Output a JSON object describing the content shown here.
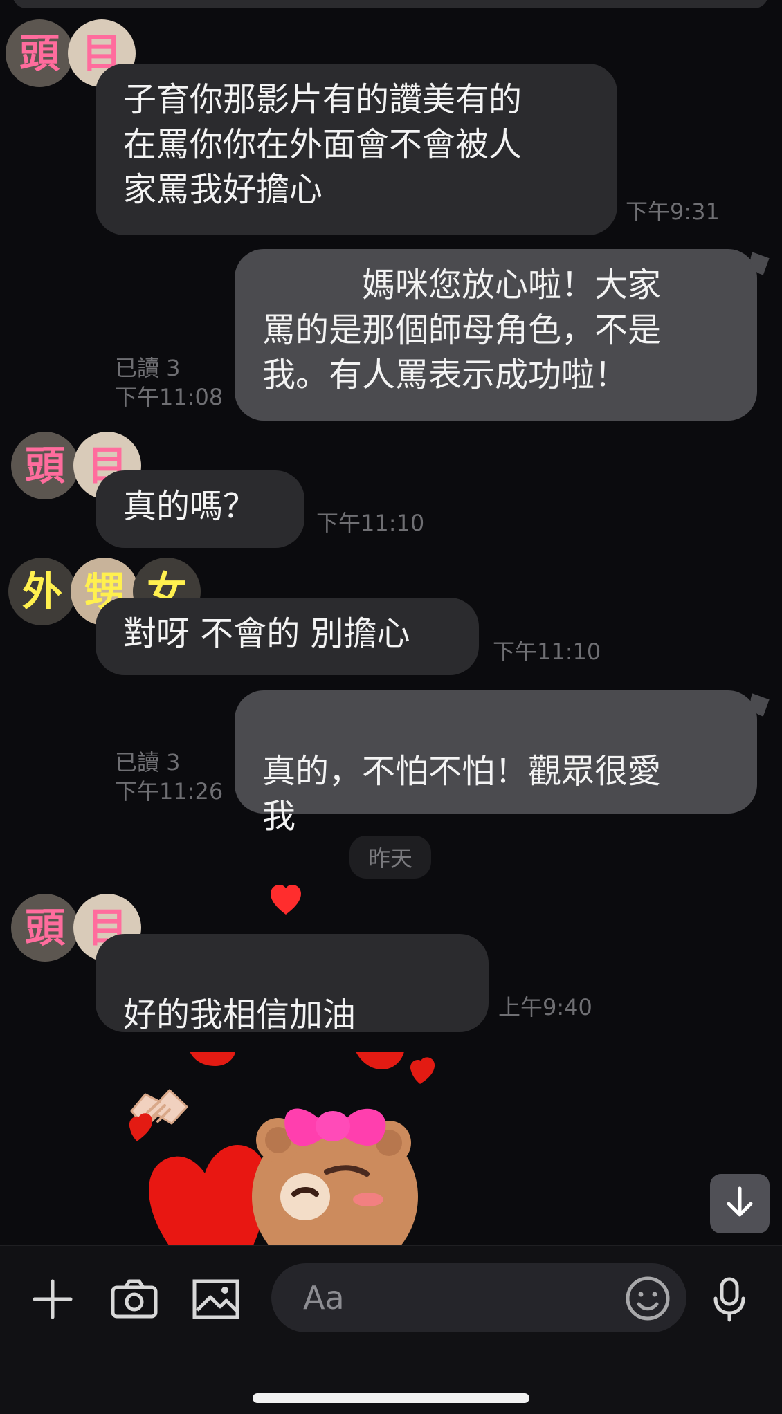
{
  "messages": [
    {
      "text": "子育你那影片有的讚美有的\n在罵你你在外面會不會被人\n家罵我好擔心",
      "time": "下午9:31"
    },
    {
      "text": "　　　媽咪您放心啦！大家\n罵的是那個師母角色，不是\n我。有人罵表示成功啦！",
      "read": "已讀 3",
      "time": "下午11:08"
    },
    {
      "text": "真的嗎？",
      "time": "下午11:10"
    },
    {
      "text": "對呀 不會的 別擔心",
      "time": "下午11:10"
    },
    {
      "text": "真的，不怕不怕！觀眾很愛\n我",
      "read": "已讀 3",
      "time": "下午11:26"
    },
    {
      "text": "好的我相信加油",
      "time": "上午9:40"
    }
  ],
  "senders": {
    "head": [
      "頭",
      "目"
    ],
    "niece": [
      "外",
      "甥",
      "女"
    ]
  },
  "date_separator": "昨天",
  "input_bar": {
    "placeholder": "Aa",
    "icons": [
      "plus-icon",
      "camera-icon",
      "image-icon",
      "emoji-icon",
      "microphone-icon"
    ]
  },
  "colors": {
    "background": "#0b0b0e",
    "incoming_bubble": "#2b2b2e",
    "outgoing_bubble": "#4b4b4f",
    "pink_nickname": "#ff6c9d",
    "yellow_nickname": "#fff04f"
  }
}
